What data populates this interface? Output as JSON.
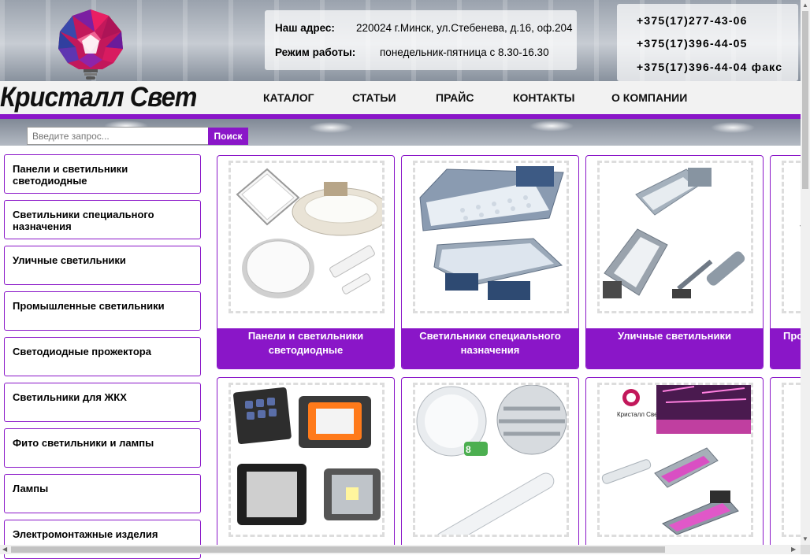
{
  "header": {
    "brand": "Кристалл Свет",
    "address_label": "Наш адрес:",
    "address_value": "220024 г.Минск, ул.Стебенева, д.16, оф.204",
    "hours_label": "Режим работы:",
    "hours_value": "понедельник-пятница с 8.30-16.30",
    "phones": [
      "+375(17)277-43-06",
      "+375(17)396-44-05",
      "+375(17)396-44-04 факс"
    ]
  },
  "nav": [
    "КАТАЛОГ",
    "СТАТЬИ",
    "ПРАЙС",
    "КОНТАКТЫ",
    "О КОМПАНИИ"
  ],
  "search": {
    "placeholder": "Введите запрос...",
    "button": "Поиск"
  },
  "sidebar": [
    "Панели и светильники светодиодные",
    "Светильники специального назначения",
    "Уличные светильники",
    "Промышленные светильники",
    "Светодиодные прожектора",
    "Светильники для ЖКХ",
    "Фито светильники и лампы",
    "Лампы",
    "Электромонтажные изделия"
  ],
  "cards_row1": [
    "Панели и светильники светодиодные",
    "Светильники специального назначения",
    "Уличные светильники",
    "Про"
  ],
  "card_photo_logo": "Кристалл Свет",
  "colors": {
    "accent": "#8a16c8"
  }
}
